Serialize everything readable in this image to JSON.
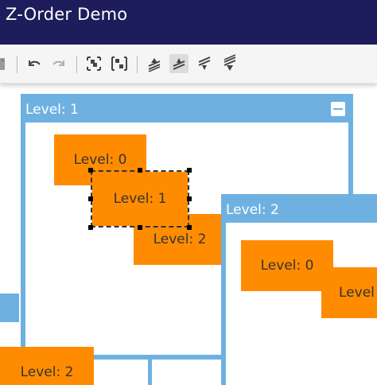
{
  "window": {
    "title": "Z-Order Demo"
  },
  "toolbar": {
    "buttons": [
      {
        "name": "paste-icon"
      },
      {
        "name": "undo-icon"
      },
      {
        "name": "redo-icon"
      },
      {
        "name": "group-icon"
      },
      {
        "name": "ungroup-icon"
      },
      {
        "name": "bring-to-front-icon"
      },
      {
        "name": "bring-forward-icon",
        "selected": true
      },
      {
        "name": "send-backward-icon"
      },
      {
        "name": "send-to-back-icon"
      }
    ]
  },
  "containers": {
    "outer": {
      "label": "Level: 1"
    },
    "inner": {
      "label": "Level: 2"
    }
  },
  "nodes": {
    "a": "Level: 0",
    "b": "Level: 1",
    "c": "Level: 2",
    "d": "Level: 0",
    "e": "Level",
    "f": "Level: 2"
  },
  "colors": {
    "titlebar": "#1d1d5b",
    "container": "#6eb1e1",
    "node": "#ff8c00"
  }
}
